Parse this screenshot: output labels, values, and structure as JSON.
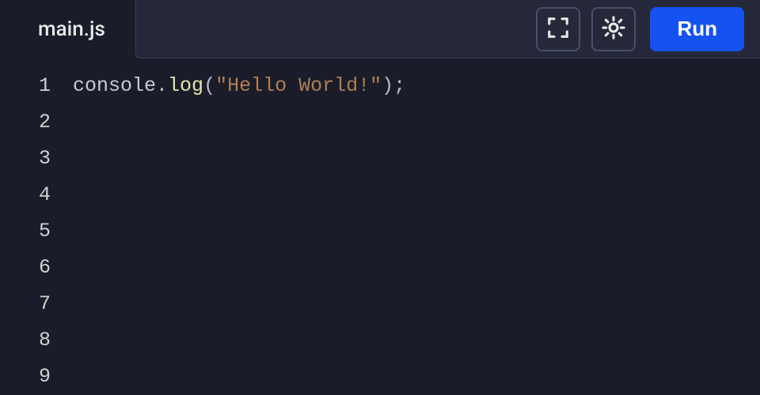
{
  "header": {
    "tab_name": "main.js",
    "run_label": "Run",
    "icons": {
      "fullscreen": "fullscreen-icon",
      "theme": "theme-icon"
    }
  },
  "editor": {
    "line_count": 9,
    "line_numbers": [
      "1",
      "2",
      "3",
      "4",
      "5",
      "6",
      "7",
      "8",
      "9"
    ],
    "lines": [
      [
        {
          "t": "console",
          "c": "tok-ident"
        },
        {
          "t": ".",
          "c": "tok-punct"
        },
        {
          "t": "log",
          "c": "tok-func"
        },
        {
          "t": "(",
          "c": "tok-punct"
        },
        {
          "t": "\"Hello World!\"",
          "c": "tok-string"
        },
        {
          "t": ")",
          "c": "tok-punct"
        },
        {
          "t": ";",
          "c": "tok-punct"
        }
      ],
      [],
      [],
      [],
      [],
      [],
      [],
      [],
      []
    ]
  }
}
